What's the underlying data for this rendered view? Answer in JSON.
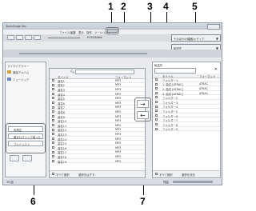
{
  "window": {
    "title": "SonicStage Ver..."
  },
  "callouts": [
    "1",
    "2",
    "3",
    "4",
    "5",
    "6",
    "7"
  ],
  "toolbar": {
    "menu_items": [
      "ファイル",
      "編集",
      "表示",
      "操作",
      "ツール",
      "ヘルプ"
    ],
    "pool_button": "POOLBANK",
    "mode_label": "切り替え",
    "dropdown_top": "そのほかの機器/メディア",
    "dropdown_bottom": "転送先"
  },
  "library": {
    "header": "マイライブラリー",
    "items": [
      "楽曲アルバム",
      "ミュージック"
    ],
    "options": [
      "未再生",
      "最近ログインで使った",
      "プレイリスト"
    ],
    "search_placeholder": "キーワード",
    "columns": [
      "",
      "タイトル",
      "フォーマット"
    ],
    "rows": [
      {
        "title": "曲名1",
        "format": "MP3"
      },
      {
        "title": "曲名2",
        "format": "MP3"
      },
      {
        "title": "曲名3",
        "format": "MP3"
      },
      {
        "title": "曲名4",
        "format": "MP3"
      },
      {
        "title": "曲名5",
        "format": "MP3"
      },
      {
        "title": "曲名6",
        "format": "MP3"
      },
      {
        "title": "曲名7",
        "format": "MP3"
      },
      {
        "title": "曲名8",
        "format": "MP3"
      },
      {
        "title": "曲名9",
        "format": "MP3"
      },
      {
        "title": "曲名10",
        "format": "MP3"
      },
      {
        "title": "曲名11",
        "format": "MP3"
      },
      {
        "title": "曲名12",
        "format": "MP3"
      },
      {
        "title": "曲名13",
        "format": "MP3"
      },
      {
        "title": "曲名14",
        "format": "MP3"
      },
      {
        "title": "曲名15",
        "format": "MP3"
      },
      {
        "title": "曲名16",
        "format": "MP3"
      },
      {
        "title": "曲名17",
        "format": "MP3"
      },
      {
        "title": "曲名18",
        "format": "MP3"
      },
      {
        "title": "曲名19",
        "format": "MP3"
      }
    ],
    "footer_check": "すべて選択",
    "footer_text": "選択をはずす"
  },
  "transfer": {
    "right_arrow": "→",
    "left_arrow": "←"
  },
  "device": {
    "header": "転送先",
    "select": "Walkman",
    "columns": [
      "タイトル",
      "フォーマット"
    ],
    "rows": [
      {
        "title": "フォルダー1",
        "format": ""
      },
      {
        "title": "1. 曲名 [ATRAC]",
        "format": "ATRAC"
      },
      {
        "title": "2. 曲名 [ATRAC]",
        "format": "ATRAC"
      },
      {
        "title": "3. 曲名 [ATRAC]",
        "format": "ATRAC"
      },
      {
        "title": "フォルダー2",
        "format": ""
      },
      {
        "title": "フォルダー3",
        "format": ""
      },
      {
        "title": "フォルダー4",
        "format": ""
      },
      {
        "title": "フォルダー5",
        "format": ""
      },
      {
        "title": "フォルダー6",
        "format": ""
      },
      {
        "title": "フォルダー7",
        "format": ""
      },
      {
        "title": "フォルダー8",
        "format": ""
      },
      {
        "title": "フォルダー9",
        "format": ""
      }
    ],
    "footer_text": "すべて選択",
    "footer_text2": "選択を消去"
  },
  "status": {
    "left": "19 曲",
    "right": "残量"
  }
}
